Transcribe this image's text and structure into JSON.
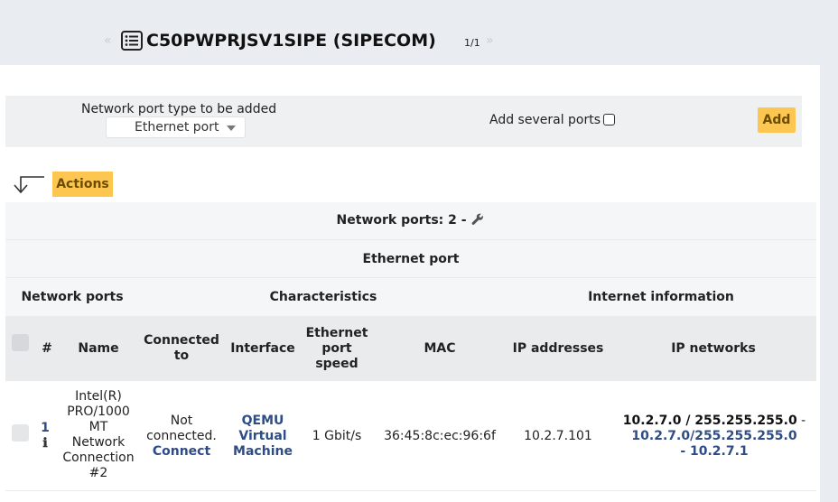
{
  "header": {
    "nav_first": "«",
    "nav_last": "»",
    "title": "C50PWPRJSV1SIPE (SIPECOM)",
    "page_count": "1/1"
  },
  "add_ports": {
    "type_label": "Network port type to be added",
    "type_value": "Ethernet port",
    "several_label": "Add several ports",
    "add_label": "Add"
  },
  "actions": {
    "label": "Actions"
  },
  "table": {
    "summary": "Network ports: 2 -",
    "port_type": "Ethernet port",
    "groups": [
      "Network ports",
      "Characteristics",
      "Internet information"
    ],
    "columns": {
      "index": "#",
      "name": "Name",
      "connected_to": "Connected to",
      "interface": "Interface",
      "speed": "Ethernet port speed",
      "mac": "MAC",
      "ip_addresses": "IP addresses",
      "ip_networks": "IP networks"
    },
    "rows": [
      {
        "index": "1",
        "name": "Intel(R) PRO/1000 MT Network Connection #2",
        "connected_status": "Not connected.",
        "connect_label": "Connect",
        "interface": "QEMU Virtual Machine",
        "speed": "1 Gbit/s",
        "mac": "36:45:8c:ec:96:6f",
        "ip_address": "10.2.7.101",
        "ip_network_bold": "10.2.7.0 / 255.255.255.0",
        "ip_network_sep": " -",
        "ip_network_link": "10.2.7.0/255.255.255.0",
        "ip_network_tail": "- 10.2.7.1"
      }
    ]
  },
  "colors": {
    "accent_button": "#fdc650",
    "link": "#2f4c84",
    "background": "#e9edf1"
  }
}
